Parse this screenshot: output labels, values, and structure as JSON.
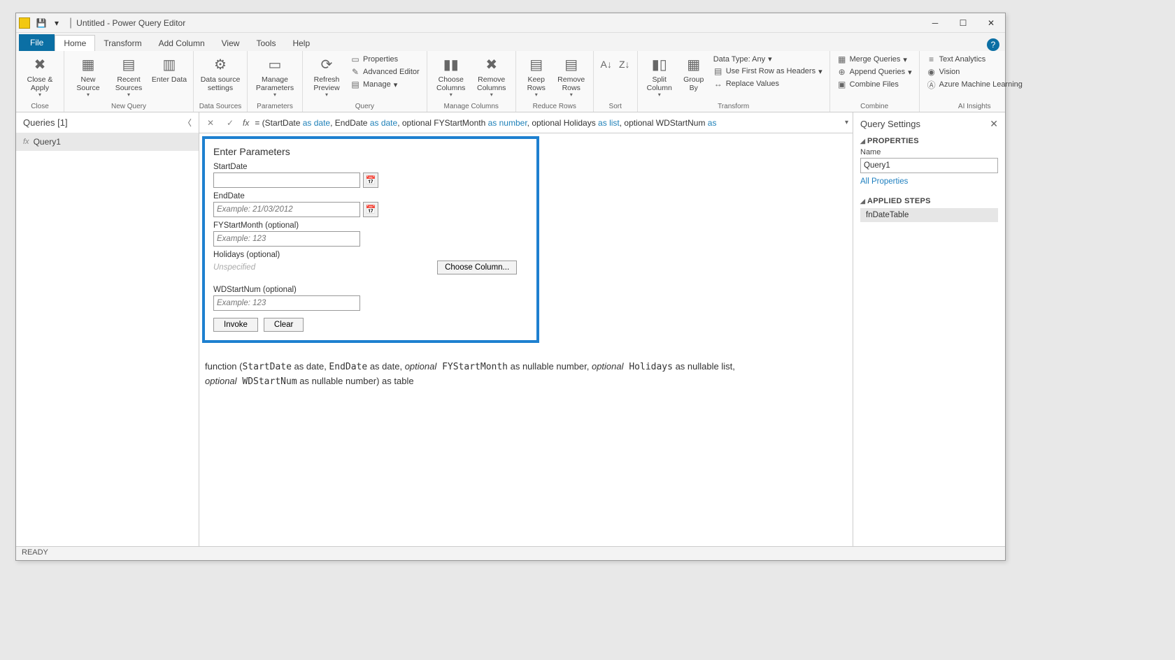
{
  "titlebar": {
    "title": "Untitled - Power Query Editor"
  },
  "tabs": {
    "file": "File",
    "home": "Home",
    "transform": "Transform",
    "add_column": "Add Column",
    "view": "View",
    "tools": "Tools",
    "help": "Help"
  },
  "ribbon": {
    "close_apply": "Close & Apply",
    "close_group": "Close",
    "new_source": "New Source",
    "recent_sources": "Recent Sources",
    "enter_data": "Enter Data",
    "new_query_group": "New Query",
    "data_source_settings": "Data source settings",
    "data_sources_group": "Data Sources",
    "manage_parameters": "Manage Parameters",
    "parameters_group": "Parameters",
    "refresh_preview": "Refresh Preview",
    "properties": "Properties",
    "advanced_editor": "Advanced Editor",
    "manage": "Manage",
    "query_group": "Query",
    "choose_columns": "Choose Columns",
    "remove_columns": "Remove Columns",
    "manage_columns_group": "Manage Columns",
    "keep_rows": "Keep Rows",
    "remove_rows": "Remove Rows",
    "reduce_rows_group": "Reduce Rows",
    "sort_group": "Sort",
    "split_column": "Split Column",
    "group_by": "Group By",
    "data_type": "Data Type: Any",
    "first_row_headers": "Use First Row as Headers",
    "replace_values": "Replace Values",
    "transform_group": "Transform",
    "merge_queries": "Merge Queries",
    "append_queries": "Append Queries",
    "combine_files": "Combine Files",
    "combine_group": "Combine",
    "text_analytics": "Text Analytics",
    "vision": "Vision",
    "azure_ml": "Azure Machine Learning",
    "ai_group": "AI Insights"
  },
  "queries": {
    "header": "Queries [1]",
    "item1": "Query1"
  },
  "formula": {
    "prefix": "= (StartDate ",
    "as1": "as",
    "date1": " date",
    "c1": ", EndDate ",
    "as2": "as",
    "date2": " date",
    "c2": ", optional FYStartMonth ",
    "as3": "as",
    "num": " number",
    "c3": ", optional Holidays ",
    "as4": "as",
    "list": " list",
    "c4": ", optional WDStartNum ",
    "as5": "as"
  },
  "params": {
    "heading": "Enter Parameters",
    "start_date_label": "StartDate",
    "end_date_label": "EndDate",
    "end_date_placeholder": "Example: 21/03/2012",
    "fystart_label": "FYStartMonth (optional)",
    "fystart_placeholder": "Example: 123",
    "holidays_label": "Holidays (optional)",
    "unspecified": "Unspecified",
    "choose_column": "Choose Column...",
    "wdstart_label": "WDStartNum (optional)",
    "wdstart_placeholder": "Example: 123",
    "invoke": "Invoke",
    "clear": "Clear"
  },
  "signature": {
    "line1a": "function (",
    "line1b": "StartDate",
    "line1c": " as date, ",
    "line1d": "EndDate",
    "line1e": " as date, ",
    "line1f": "optional",
    "line1g": " FYStartMonth",
    "line1h": " as nullable number, ",
    "line1i": "optional",
    "line1j": " Holidays",
    "line1k": " as nullable list,",
    "line2a": "optional",
    "line2b": " WDStartNum",
    "line2c": " as nullable number) as table"
  },
  "settings": {
    "title": "Query Settings",
    "properties": "PROPERTIES",
    "name_label": "Name",
    "name_value": "Query1",
    "all_properties": "All Properties",
    "applied_steps": "APPLIED STEPS",
    "step1": "fnDateTable"
  },
  "status": "READY"
}
